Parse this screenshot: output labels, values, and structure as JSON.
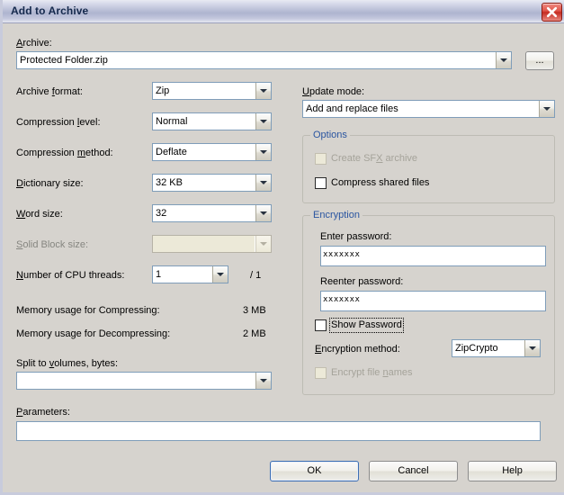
{
  "window": {
    "title": "Add to Archive",
    "close_icon": "close-icon"
  },
  "archive": {
    "label": "Archive:",
    "label_accel": "A",
    "value": "Protected Folder.zip",
    "browse_label": "..."
  },
  "left_column": {
    "archive_format": {
      "label": "Archive format:",
      "value": "Zip",
      "enabled": true
    },
    "compression_level": {
      "label": "Compression level:",
      "value": "Normal",
      "enabled": true
    },
    "compression_method": {
      "label": "Compression method:",
      "value": "Deflate",
      "enabled": true
    },
    "dictionary_size": {
      "label": "Dictionary size:",
      "value": "32 KB",
      "enabled": true
    },
    "word_size": {
      "label": "Word size:",
      "value": "32",
      "enabled": true
    },
    "solid_block_size": {
      "label": "Solid Block size:",
      "value": "",
      "enabled": false
    },
    "cpu_threads": {
      "label": "Number of CPU threads:",
      "value": "1",
      "max_suffix": "/ 1",
      "enabled": true
    },
    "memory_compress": {
      "label": "Memory usage for Compressing:",
      "value": "3 MB"
    },
    "memory_decompress": {
      "label": "Memory usage for Decompressing:",
      "value": "2 MB"
    },
    "split_volumes": {
      "label": "Split to volumes, bytes:",
      "value": ""
    },
    "parameters": {
      "label": "Parameters:",
      "value": ""
    }
  },
  "right_column": {
    "update_mode": {
      "label": "Update mode:",
      "value": "Add and replace files"
    },
    "options": {
      "title": "Options",
      "create_sfx": {
        "label": "Create SFX archive",
        "checked": false,
        "enabled": false
      },
      "compress_shared": {
        "label": "Compress shared files",
        "checked": false,
        "enabled": true
      }
    },
    "encryption": {
      "title": "Encryption",
      "enter_password_label": "Enter password:",
      "enter_password_value": "xxxxxxx",
      "reenter_password_label": "Reenter password:",
      "reenter_password_value": "xxxxxxx",
      "show_password": {
        "label": "Show Password",
        "checked": false,
        "enabled": true,
        "focused": true
      },
      "encryption_method_label": "Encryption method:",
      "encryption_method_value": "ZipCrypto",
      "encrypt_file_names": {
        "label": "Encrypt file names",
        "checked": false,
        "enabled": false
      }
    }
  },
  "buttons": {
    "ok": "OK",
    "cancel": "Cancel",
    "help": "Help"
  },
  "colors": {
    "dialog_bg": "#d6d3ce",
    "group_title": "#2a55a0",
    "field_border": "#7f9db9",
    "title_text": "#15294d",
    "close_red": "#c52c22"
  }
}
